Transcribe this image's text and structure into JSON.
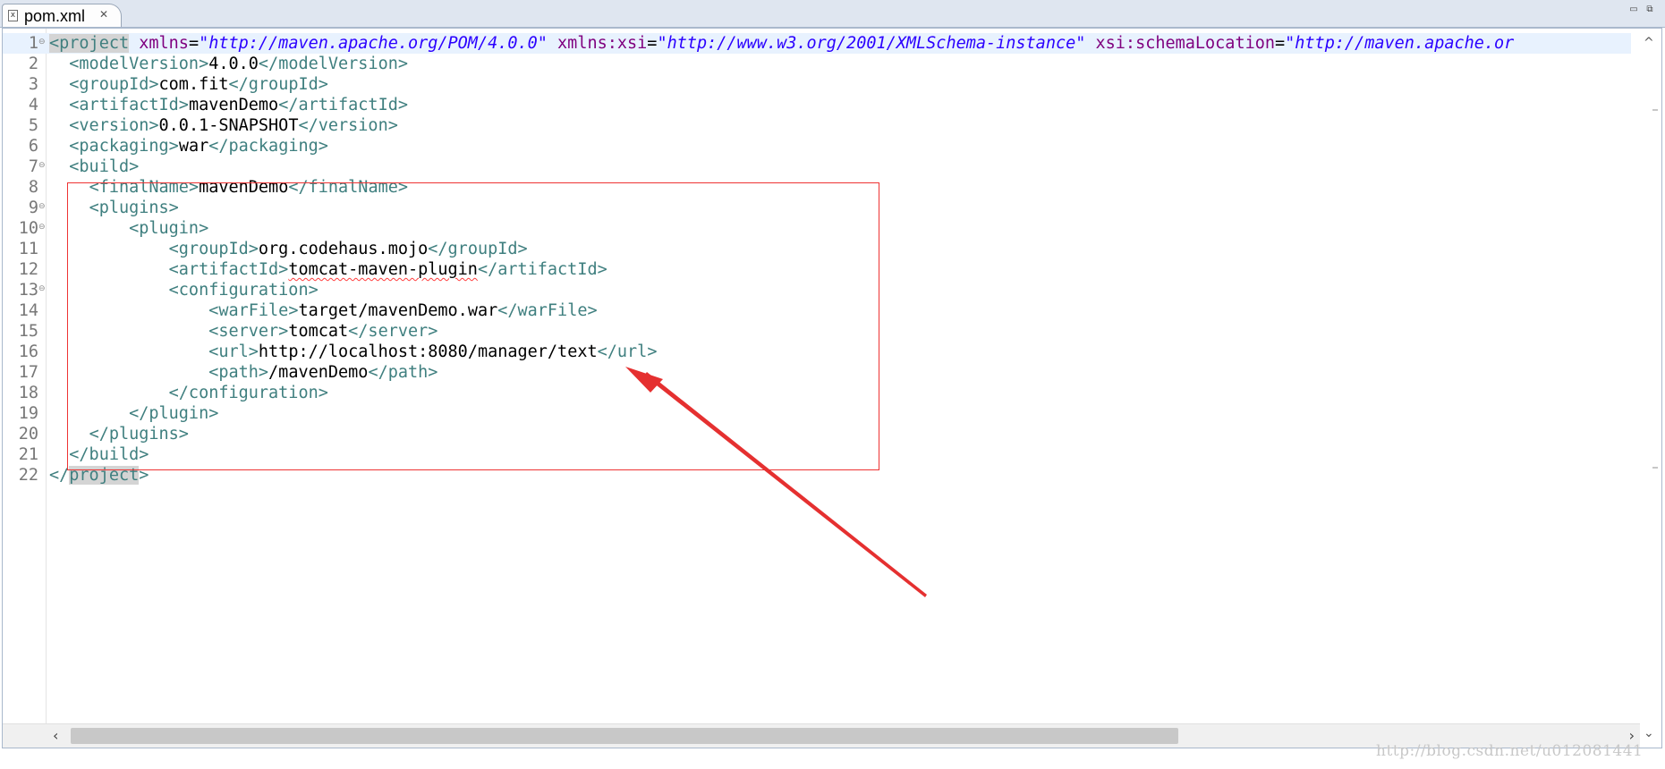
{
  "tab": {
    "icon": "xml-file-icon",
    "label": "pom.xml",
    "close_icon": "close-icon"
  },
  "window_controls": {
    "minimize": "minimize-icon",
    "maximize": "maximize-icon"
  },
  "editor": {
    "current_line": 1,
    "lines": [
      {
        "n": "1",
        "fold": true,
        "indent": "",
        "parts": [
          {
            "t": "<",
            "c": "tag",
            "hl": true
          },
          {
            "t": "project",
            "c": "tag",
            "hl": true
          },
          {
            "t": " xmlns",
            "c": "attr"
          },
          {
            "t": "=",
            "c": "eq"
          },
          {
            "t": "\"http://maven.apache.org/POM/4.0.0\"",
            "c": "val"
          },
          {
            "t": " xmlns:xsi",
            "c": "attr"
          },
          {
            "t": "=",
            "c": "eq"
          },
          {
            "t": "\"http://www.w3.org/2001/XMLSchema-instance\"",
            "c": "val"
          },
          {
            "t": " xsi:schemaLocation",
            "c": "attr"
          },
          {
            "t": "=",
            "c": "eq"
          },
          {
            "t": "\"http://maven.apache.or",
            "c": "val"
          }
        ]
      },
      {
        "n": "2",
        "indent": "  ",
        "parts": [
          {
            "t": "<modelVersion>",
            "c": "tag"
          },
          {
            "t": "4.0.0",
            "c": ""
          },
          {
            "t": "</modelVersion>",
            "c": "tag"
          }
        ]
      },
      {
        "n": "3",
        "indent": "  ",
        "parts": [
          {
            "t": "<groupId>",
            "c": "tag"
          },
          {
            "t": "com.fit",
            "c": ""
          },
          {
            "t": "</groupId>",
            "c": "tag"
          }
        ]
      },
      {
        "n": "4",
        "indent": "  ",
        "parts": [
          {
            "t": "<artifactId>",
            "c": "tag"
          },
          {
            "t": "mavenDemo",
            "c": ""
          },
          {
            "t": "</artifactId>",
            "c": "tag"
          }
        ]
      },
      {
        "n": "5",
        "indent": "  ",
        "parts": [
          {
            "t": "<version>",
            "c": "tag"
          },
          {
            "t": "0.0.1-SNAPSHOT",
            "c": ""
          },
          {
            "t": "</version>",
            "c": "tag"
          }
        ]
      },
      {
        "n": "6",
        "indent": "  ",
        "parts": [
          {
            "t": "<packaging>",
            "c": "tag"
          },
          {
            "t": "war",
            "c": ""
          },
          {
            "t": "</packaging>",
            "c": "tag"
          }
        ]
      },
      {
        "n": "7",
        "fold": true,
        "indent": "  ",
        "parts": [
          {
            "t": "<build>",
            "c": "tag"
          }
        ]
      },
      {
        "n": "8",
        "indent": "    ",
        "parts": [
          {
            "t": "<finalName>",
            "c": "tag"
          },
          {
            "t": "mavenDemo",
            "c": ""
          },
          {
            "t": "</finalName>",
            "c": "tag"
          }
        ]
      },
      {
        "n": "9",
        "fold": true,
        "indent": "    ",
        "parts": [
          {
            "t": "<plugins>",
            "c": "tag"
          }
        ]
      },
      {
        "n": "10",
        "fold": true,
        "indent": "        ",
        "parts": [
          {
            "t": "<plugin>",
            "c": "tag"
          }
        ]
      },
      {
        "n": "11",
        "indent": "            ",
        "parts": [
          {
            "t": "<groupId>",
            "c": "tag"
          },
          {
            "t": "org.codehaus.mojo",
            "c": ""
          },
          {
            "t": "</groupId>",
            "c": "tag"
          }
        ]
      },
      {
        "n": "12",
        "indent": "            ",
        "parts": [
          {
            "t": "<artifactId>",
            "c": "tag"
          },
          {
            "t": "tomcat-maven-plugin",
            "c": "squiggle"
          },
          {
            "t": "</artifactId>",
            "c": "tag"
          }
        ]
      },
      {
        "n": "13",
        "fold": true,
        "indent": "            ",
        "parts": [
          {
            "t": "<configuration>",
            "c": "tag"
          }
        ]
      },
      {
        "n": "14",
        "indent": "                ",
        "parts": [
          {
            "t": "<warFile>",
            "c": "tag"
          },
          {
            "t": "target/mavenDemo.war",
            "c": ""
          },
          {
            "t": "</warFile>",
            "c": "tag"
          }
        ]
      },
      {
        "n": "15",
        "indent": "                ",
        "parts": [
          {
            "t": "<server>",
            "c": "tag"
          },
          {
            "t": "tomcat",
            "c": ""
          },
          {
            "t": "</server>",
            "c": "tag"
          }
        ]
      },
      {
        "n": "16",
        "indent": "                ",
        "parts": [
          {
            "t": "<url>",
            "c": "tag"
          },
          {
            "t": "http://localhost:8080/manager/text",
            "c": ""
          },
          {
            "t": "</url>",
            "c": "tag"
          }
        ]
      },
      {
        "n": "17",
        "indent": "                ",
        "parts": [
          {
            "t": "<path>",
            "c": "tag"
          },
          {
            "t": "/mavenDemo",
            "c": ""
          },
          {
            "t": "</path>",
            "c": "tag"
          }
        ]
      },
      {
        "n": "18",
        "indent": "            ",
        "parts": [
          {
            "t": "</configuration>",
            "c": "tag"
          }
        ]
      },
      {
        "n": "19",
        "indent": "        ",
        "parts": [
          {
            "t": "</plugin>",
            "c": "tag"
          }
        ]
      },
      {
        "n": "20",
        "indent": "    ",
        "parts": [
          {
            "t": "</plugins>",
            "c": "tag"
          }
        ]
      },
      {
        "n": "21",
        "indent": "  ",
        "parts": [
          {
            "t": "</build>",
            "c": "tag"
          }
        ]
      },
      {
        "n": "22",
        "indent": "",
        "parts": [
          {
            "t": "</",
            "c": "tag"
          },
          {
            "t": "project",
            "c": "tag",
            "hl": true
          },
          {
            "t": ">",
            "c": "tag"
          }
        ]
      }
    ]
  },
  "annotation": {
    "box_color": "#ee3333",
    "arrow_color": "#e53030"
  },
  "colors": {
    "tag": "#3f7f7f",
    "attribute": "#7f007f",
    "value": "#2a00ff",
    "text": "#000000"
  },
  "watermark": "http://blog.csdn.net/u012081441"
}
